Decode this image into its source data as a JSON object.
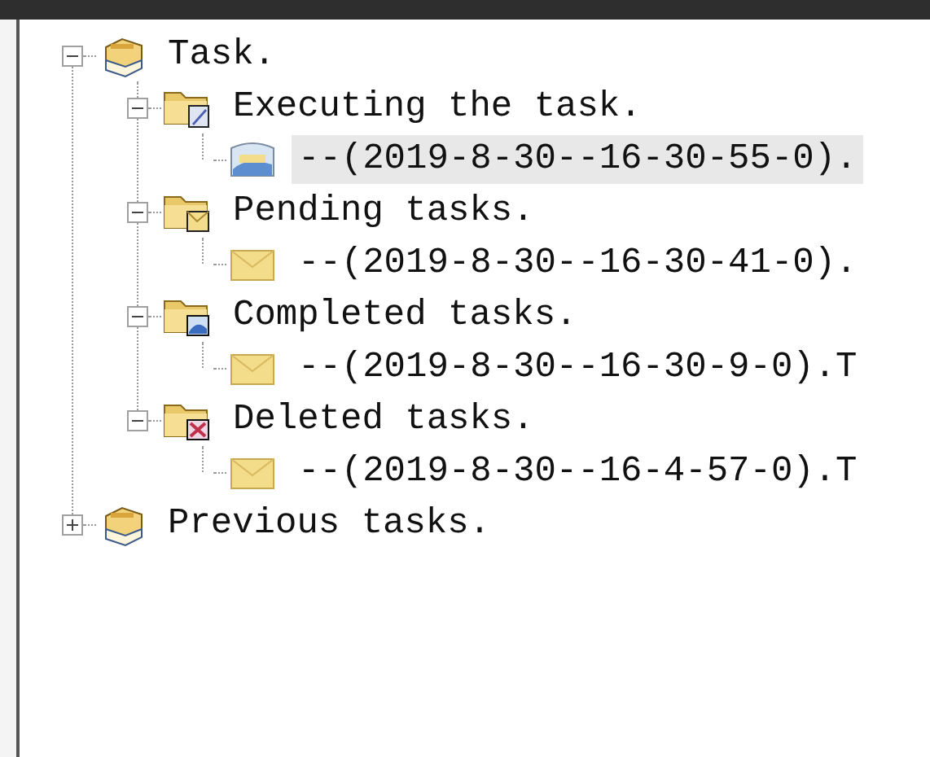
{
  "tree": [
    {
      "label": "Task.",
      "kind": "box",
      "expanded": true,
      "selected": false,
      "children": [
        {
          "label": "Executing the task.",
          "kind": "folder-edit",
          "expanded": true,
          "selected": false,
          "children": [
            {
              "label": "--(2019-8-30--16-30-55-0).",
              "kind": "mail-open",
              "selected": true
            }
          ]
        },
        {
          "label": "Pending tasks.",
          "kind": "folder-mail",
          "expanded": true,
          "selected": false,
          "children": [
            {
              "label": "--(2019-8-30--16-30-41-0).",
              "kind": "mail",
              "selected": false
            }
          ]
        },
        {
          "label": "Completed tasks.",
          "kind": "folder-image",
          "expanded": true,
          "selected": false,
          "children": [
            {
              "label": "--(2019-8-30--16-30-9-0).T",
              "kind": "mail",
              "selected": false
            }
          ]
        },
        {
          "label": "Deleted tasks.",
          "kind": "folder-delete",
          "expanded": true,
          "selected": false,
          "children": [
            {
              "label": "--(2019-8-30--16-4-57-0).T",
              "kind": "mail",
              "selected": false
            }
          ]
        }
      ]
    },
    {
      "label": "Previous tasks.",
      "kind": "box",
      "expanded": false,
      "selected": false
    }
  ]
}
